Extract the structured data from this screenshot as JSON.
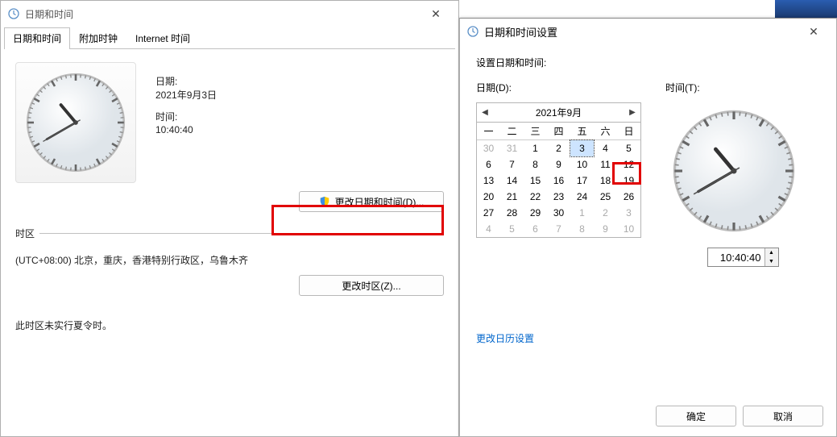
{
  "left": {
    "title": "日期和时间",
    "tabs": [
      "日期和时间",
      "附加时钟",
      "Internet 时间"
    ],
    "date_label": "日期:",
    "date_value": "2021年9月3日",
    "time_label": "时间:",
    "time_value": "10:40:40",
    "change_dt_btn": "更改日期和时间(D)...",
    "tz_heading": "时区",
    "tz_value": "(UTC+08:00) 北京，重庆，香港特别行政区，乌鲁木齐",
    "change_tz_btn": "更改时区(Z)...",
    "dst_note": "此时区未实行夏令时。"
  },
  "right": {
    "title": "日期和时间设置",
    "heading": "设置日期和时间:",
    "date_label": "日期(D):",
    "time_label": "时间(T):",
    "cal_month": "2021年9月",
    "weekdays": [
      "一",
      "二",
      "三",
      "四",
      "五",
      "六",
      "日"
    ],
    "weeks": [
      [
        {
          "d": 30,
          "dim": true
        },
        {
          "d": 31,
          "dim": true
        },
        {
          "d": 1
        },
        {
          "d": 2
        },
        {
          "d": 3,
          "sel": true
        },
        {
          "d": 4
        },
        {
          "d": 5
        }
      ],
      [
        {
          "d": 6
        },
        {
          "d": 7
        },
        {
          "d": 8
        },
        {
          "d": 9
        },
        {
          "d": 10
        },
        {
          "d": 11
        },
        {
          "d": 12
        }
      ],
      [
        {
          "d": 13
        },
        {
          "d": 14
        },
        {
          "d": 15
        },
        {
          "d": 16
        },
        {
          "d": 17
        },
        {
          "d": 18
        },
        {
          "d": 19
        }
      ],
      [
        {
          "d": 20
        },
        {
          "d": 21
        },
        {
          "d": 22
        },
        {
          "d": 23
        },
        {
          "d": 24
        },
        {
          "d": 25
        },
        {
          "d": 26
        }
      ],
      [
        {
          "d": 27
        },
        {
          "d": 28
        },
        {
          "d": 29
        },
        {
          "d": 30
        },
        {
          "d": 1,
          "dim": true
        },
        {
          "d": 2,
          "dim": true
        },
        {
          "d": 3,
          "dim": true
        }
      ],
      [
        {
          "d": 4,
          "dim": true
        },
        {
          "d": 5,
          "dim": true
        },
        {
          "d": 6,
          "dim": true
        },
        {
          "d": 7,
          "dim": true
        },
        {
          "d": 8,
          "dim": true
        },
        {
          "d": 9,
          "dim": true
        },
        {
          "d": 10,
          "dim": true
        }
      ]
    ],
    "time_value": "10:40:40",
    "change_cal_link": "更改日历设置",
    "ok_btn": "确定",
    "cancel_btn": "取消"
  },
  "clock": {
    "h": 10,
    "m": 40,
    "s": 40
  }
}
